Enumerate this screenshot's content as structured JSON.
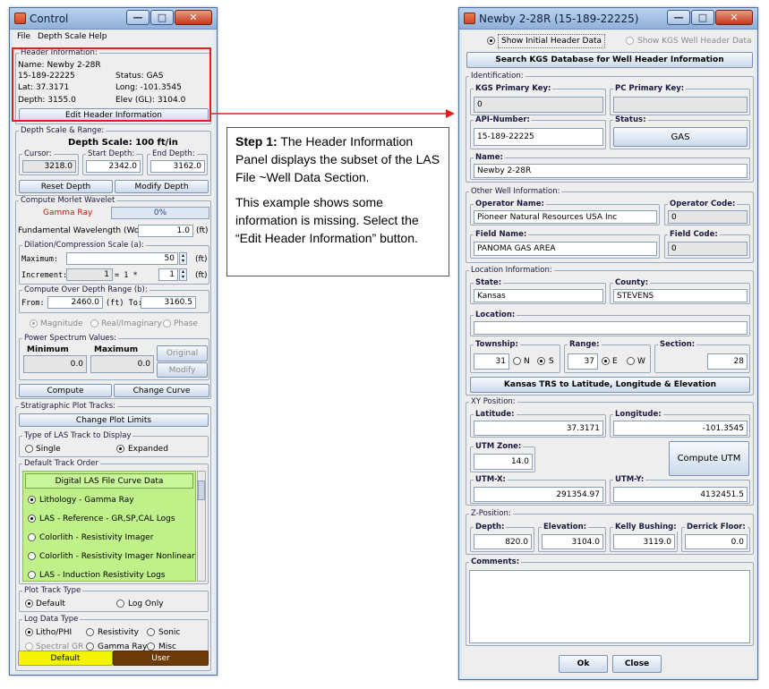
{
  "control": {
    "title": "Control",
    "menu": [
      "File",
      "Depth Scale",
      "Help"
    ],
    "header_info": {
      "title": "Header Information:",
      "name": "Name: Newby 2-28R",
      "api": "15-189-22225",
      "status": "Status: GAS",
      "lat": "Lat: 37.3171",
      "long": "Long: -101.3545",
      "depth": "Depth: 3155.0",
      "elev": "Elev (GL): 3104.0",
      "edit_button": "Edit Header Information"
    },
    "depth_scale": {
      "title": "Depth Scale & Range:",
      "scale_label": "Depth Scale: 100 ft/in",
      "cursor_label": "Cursor:",
      "cursor_value": "3218.0",
      "start_label": "Start Depth:",
      "start_value": "2342.0",
      "end_label": "End Depth:",
      "end_value": "3162.0",
      "reset_button": "Reset Depth",
      "modify_button": "Modify Depth"
    },
    "morlet": {
      "title": "Compute Morlet Wavelet",
      "curve": "Gamma Ray",
      "progress": "0%",
      "progress_fraction": 0,
      "fundamental_label": "Fundamental Wavelength (Wo):",
      "fundamental_value": "1.0",
      "unit_ft": "(ft)",
      "dilation_title": "Dilation/Compression Scale (a):",
      "max_label": "Maximum:",
      "max_value": "50",
      "inc_label": "Increment:",
      "inc_left": "1",
      "inc_formula": "= 1 *",
      "inc_value": "1",
      "range_title": "Compute Over Depth Range (b):",
      "from_label": "From:",
      "from_value": "2460.0",
      "to_label": "(ft) To:",
      "to_value": "3160.5",
      "mag_options": [
        "Magnitude",
        "Real/Imaginary",
        "Phase"
      ],
      "power_title": "Power Spectrum Values:",
      "minimum_label": "Minimum",
      "minimum_value": "0.0",
      "maximum_label": "Maximum",
      "maximum_value": "0.0",
      "original_button": "Original",
      "modify_button": "Modify",
      "compute_button": "Compute",
      "change_curve_button": "Change Curve"
    },
    "strat": {
      "title": "Stratigraphic Plot Tracks:",
      "change_limits_button": "Change Plot Limits",
      "type_title": "Type of LAS Track to Display",
      "single": "Single",
      "expanded": "Expanded",
      "order_title": "Default Track Order",
      "digital_header": "Digital LAS File Curve Data",
      "tracks": [
        "Lithology - Gamma Ray",
        "LAS - Reference - GR,SP,CAL Logs",
        "Colorlith - Resistivity Imager",
        "Colorlith - Resistivity Imager Nonlinear",
        "LAS - Induction Resistivity Logs"
      ],
      "plot_type_title": "Plot Track Type",
      "default_opt": "Default",
      "log_only_opt": "Log Only",
      "log_data_title": "Log Data Type",
      "log_types": [
        "Litho/PHI",
        "Resistivity",
        "Sonic",
        "Spectral GR",
        "Gamma Ray",
        "Misc"
      ],
      "default_button": "Default",
      "user_button": "User"
    }
  },
  "callout": {
    "step": "Step 1:",
    "text1": " The Header Information Panel displays the subset of the LAS File ~Well Data Section.",
    "text2": "This example shows some information is missing.  Select the “Edit Header Information” button."
  },
  "newby": {
    "title": "Newby 2-28R (15-189-22225)",
    "show_initial": "Show Initial Header Data",
    "show_kgs": "Show KGS Well Header Data",
    "search_button": "Search KGS Database for Well Header Information",
    "identification": {
      "title": "Identification:",
      "kgs_label": "KGS Primary Key:",
      "kgs_value": "0",
      "pc_label": "PC Primary Key:",
      "pc_value": "",
      "api_label": "API-Number:",
      "api_value": "15-189-22225",
      "status_label": "Status:",
      "status_value": "GAS",
      "name_label": "Name:",
      "name_value": "Newby 2-28R"
    },
    "other": {
      "title": "Other Well Information:",
      "operator_label": "Operator Name:",
      "operator_value": "Pioneer Natural Resources USA Inc",
      "op_code_label": "Operator Code:",
      "op_code_value": "0",
      "field_label": "Field Name:",
      "field_value": "PANOMA GAS AREA",
      "field_code_label": "Field Code:",
      "field_code_value": "0"
    },
    "location": {
      "title": "Location Information:",
      "state_label": "State:",
      "state_value": "Kansas",
      "county_label": "County:",
      "county_value": "STEVENS",
      "location_label": "Location:",
      "location_value": "",
      "township_label": "Township:",
      "township_value": "31",
      "n_label": "N",
      "s_label": "S",
      "range_label": "Range:",
      "range_value": "37",
      "e_label": "E",
      "w_label": "W",
      "section_label": "Section:",
      "section_value": "28",
      "trs_button": "Kansas TRS to Latitude, Longitude & Elevation"
    },
    "xy": {
      "title": "XY Position:",
      "lat_label": "Latitude:",
      "lat_value": "37.3171",
      "long_label": "Longitude:",
      "long_value": "-101.3545",
      "utm_zone_label": "UTM Zone:",
      "utm_zone_value": "14.0",
      "compute_utm_button": "Compute UTM",
      "utm_x_label": "UTM-X:",
      "utm_x_value": "291354.97",
      "utm_y_label": "UTM-Y:",
      "utm_y_value": "4132451.5"
    },
    "z": {
      "title": "Z-Position:",
      "depth_label": "Depth:",
      "depth_value": "820.0",
      "elev_label": "Elevation:",
      "elev_value": "3104.0",
      "kb_label": "Kelly Bushing:",
      "kb_value": "3119.0",
      "df_label": "Derrick Floor:",
      "df_value": "0.0"
    },
    "comments_label": "Comments:",
    "ok_button": "Ok",
    "close_button": "Close"
  },
  "window_buttons": {
    "minimize": "—",
    "maximize": "□",
    "close": "✕"
  }
}
